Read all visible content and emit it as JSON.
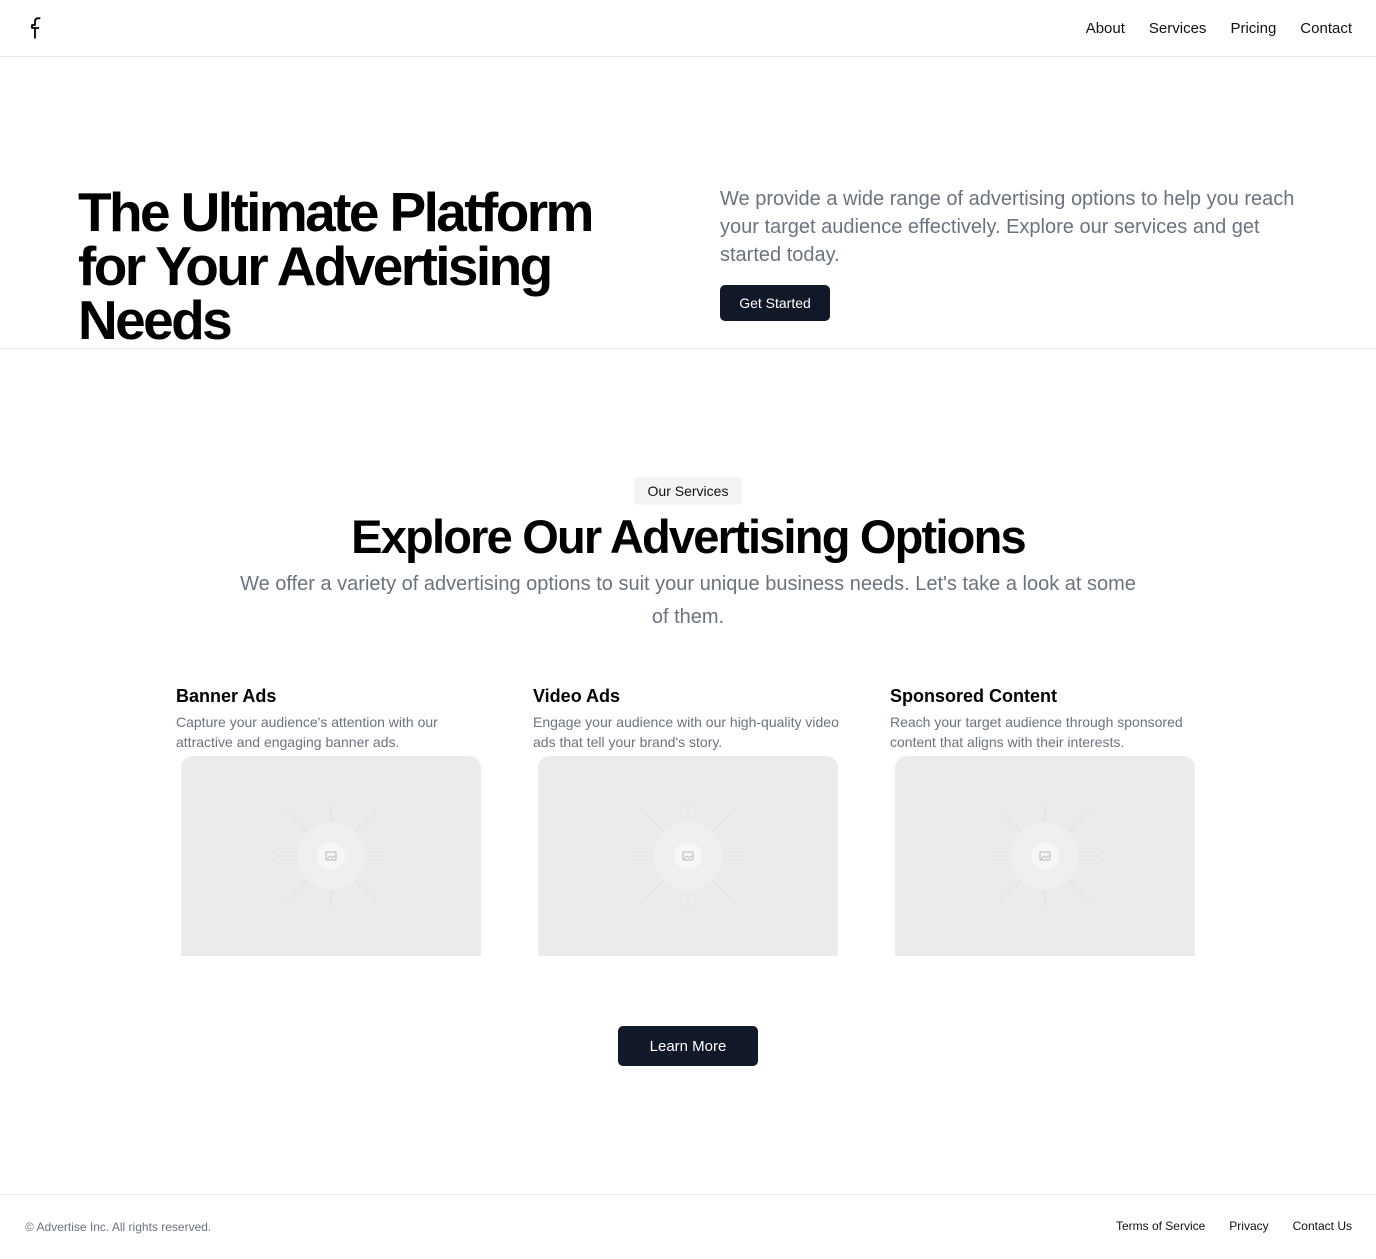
{
  "header": {
    "logo_icon": "facebook-icon",
    "nav": [
      "About",
      "Services",
      "Pricing",
      "Contact"
    ]
  },
  "hero": {
    "title": "The Ultimate Platform for Your Advertising Needs",
    "description": "We provide a wide range of advertising options to help you reach your target audience effectively. Explore our services and get started today.",
    "cta_label": "Get Started"
  },
  "services": {
    "badge": "Our Services",
    "title": "Explore Our Advertising Options",
    "description": "We offer a variety of advertising options to suit your unique business needs. Let's take a look at some of them.",
    "cards": [
      {
        "title": "Banner Ads",
        "description": "Capture your audience's attention with our attractive and engaging banner ads.",
        "image_icon": "image-placeholder-icon"
      },
      {
        "title": "Video Ads",
        "description": "Engage your audience with our high-quality video ads that tell your brand's story.",
        "image_icon": "image-placeholder-icon"
      },
      {
        "title": "Sponsored Content",
        "description": "Reach your target audience through sponsored content that aligns with their interests.",
        "image_icon": "image-placeholder-icon"
      }
    ],
    "learn_more_label": "Learn More"
  },
  "footer": {
    "copyright": "© Advertise Inc. All rights reserved.",
    "links": [
      "Terms of Service",
      "Privacy",
      "Contact Us"
    ]
  },
  "colors": {
    "primary_button": "#111827",
    "muted_text": "#6b7280",
    "border": "#e5e7eb",
    "badge_bg": "#f3f4f6",
    "placeholder_bg": "#ebebeb"
  }
}
